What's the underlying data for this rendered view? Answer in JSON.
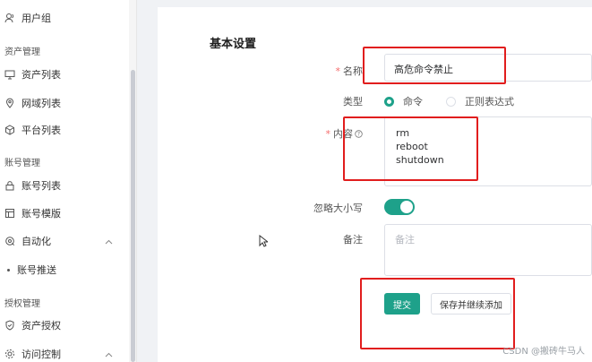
{
  "sidebar": {
    "user_group": "用户组",
    "asset_section": "资产管理",
    "asset_list": "资产列表",
    "domain_list": "网域列表",
    "platform_list": "平台列表",
    "account_section": "账号管理",
    "account_list": "账号列表",
    "account_template": "账号模版",
    "automation": "自动化",
    "account_push": "账号推送",
    "perm_section": "授权管理",
    "asset_perm": "资产授权",
    "access_control": "访问控制"
  },
  "form": {
    "title": "基本设置",
    "name_label": "名称",
    "name_value": "高危命令禁止",
    "type_label": "类型",
    "type_options": [
      "命令",
      "正则表达式"
    ],
    "type_selected": "命令",
    "content_label": "内容",
    "content_lines": [
      "rm",
      "reboot",
      "shutdown"
    ],
    "ignore_case_label": "忽略大小写",
    "ignore_case_on": true,
    "remark_label": "备注",
    "remark_placeholder": "备注",
    "submit_label": "提交",
    "save_continue_label": "保存并继续添加"
  },
  "watermark": "CSDN @搬砖牛马人",
  "colors": {
    "accent": "#1ea18a",
    "required": "#f56c6c",
    "highlight": "#e11d1d"
  }
}
